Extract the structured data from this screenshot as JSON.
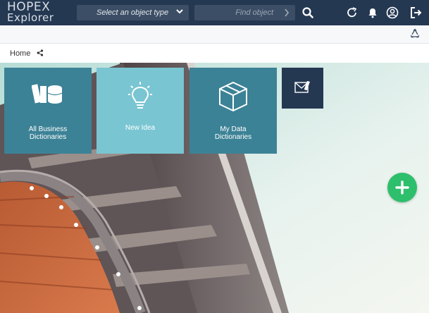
{
  "header": {
    "logo_line1": "HOPEX",
    "logo_line2": "Explorer",
    "object_type_placeholder": "Select an object type",
    "find_placeholder": "Find object",
    "icons": [
      "chevron-down-icon",
      "chevron-right-icon",
      "search-icon",
      "refresh-icon",
      "bell-icon",
      "user-icon",
      "logout-icon"
    ]
  },
  "subbar": {
    "icons": [
      "recycle-icon"
    ]
  },
  "breadcrumb": {
    "label": "Home",
    "icons": [
      "share-icon"
    ]
  },
  "tiles": [
    {
      "label": "All Business\nDictionaries",
      "color": "#3c8296",
      "icon": "dictionaries-icon"
    },
    {
      "label": "New Idea",
      "color": "#7ac5d2",
      "icon": "lightbulb-icon"
    },
    {
      "label": "My Data\nDictionaries",
      "color": "#3c8296",
      "icon": "box-icon"
    },
    {
      "label": "",
      "color": "#243852",
      "icon": "mail-icon"
    }
  ],
  "fab": {
    "icon": "plus-icon",
    "color": "#2dbf6c"
  },
  "colors": {
    "navbar": "#243852",
    "input_bg": "#3c4e65"
  }
}
